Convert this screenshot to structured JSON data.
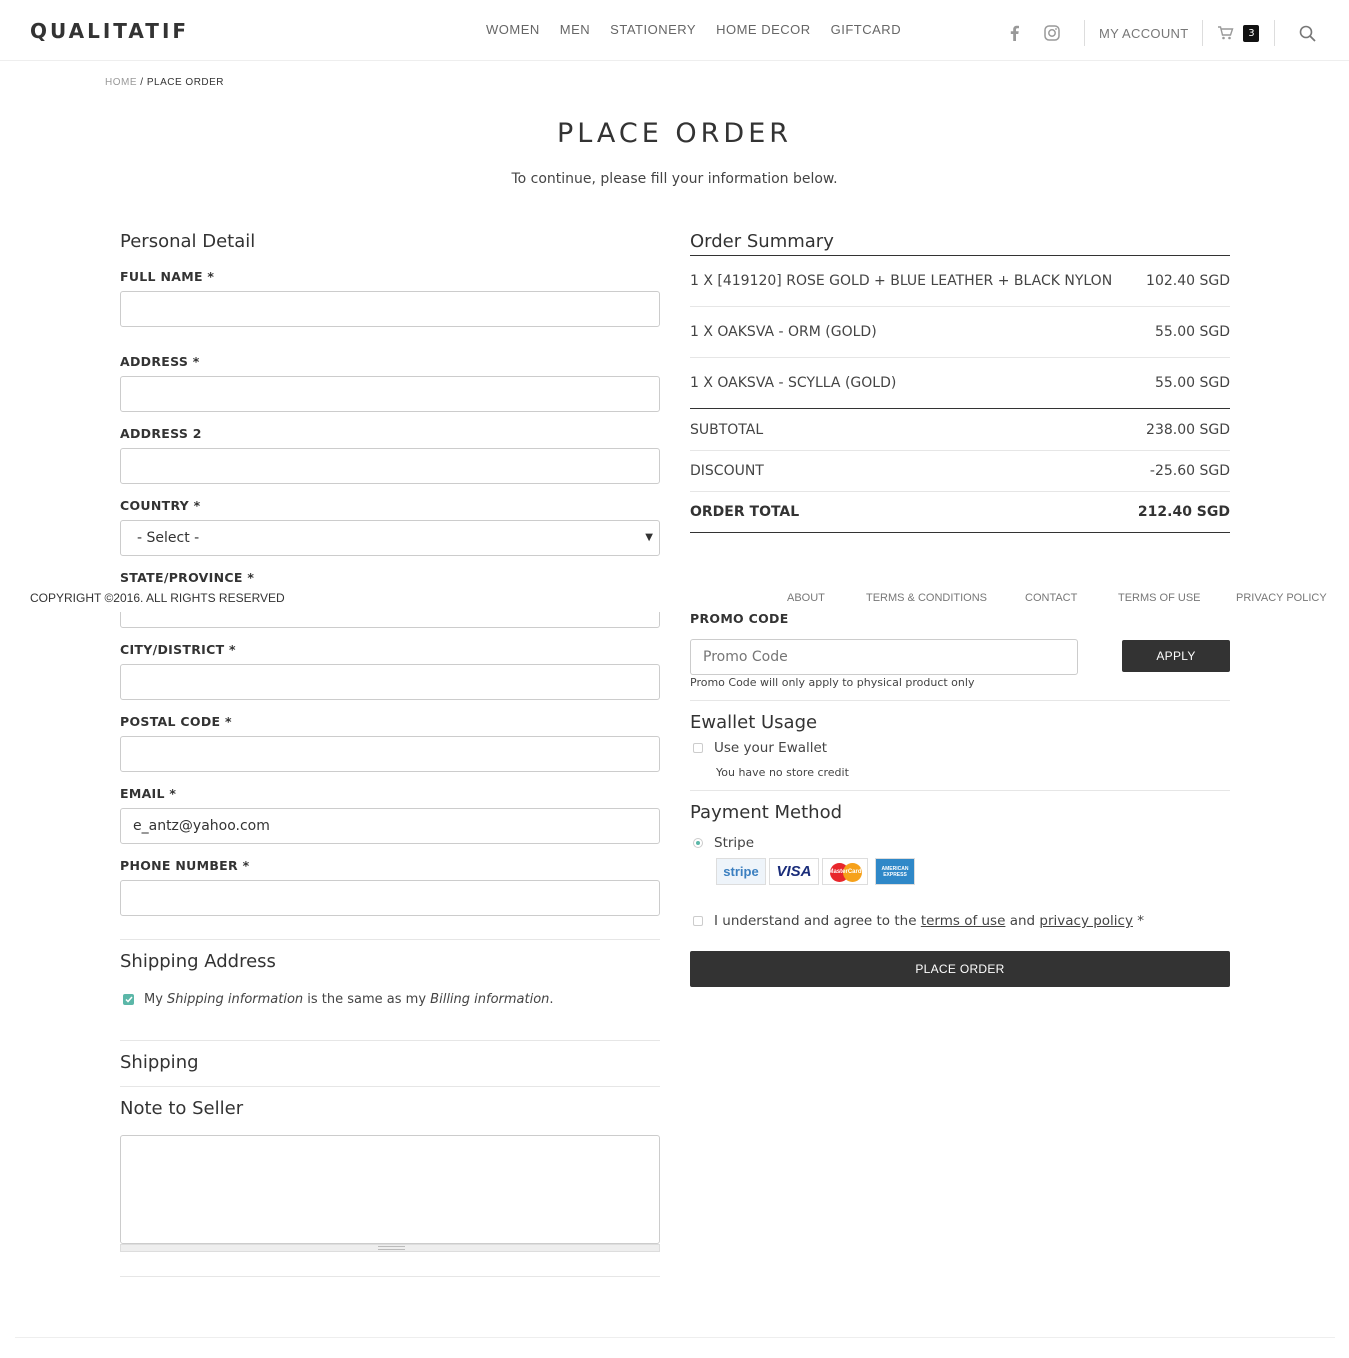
{
  "header": {
    "logo": "QUALITATIF",
    "nav": [
      "WOMEN",
      "MEN",
      "STATIONERY",
      "HOME DECOR",
      "GIFTCARD"
    ],
    "my_account": "MY ACCOUNT",
    "cart_count": "3"
  },
  "breadcrumb": {
    "home": "HOME",
    "sep": " / ",
    "current": "PLACE ORDER"
  },
  "page": {
    "title": "PLACE ORDER",
    "subtitle": "To continue, please fill your information below."
  },
  "personal": {
    "heading": "Personal Detail",
    "full_name_label": "FULL NAME *",
    "address_label": "ADDRESS *",
    "address2_label": "ADDRESS 2",
    "country_label": "COUNTRY *",
    "country_value": "- Select -",
    "state_label": "STATE/PROVINCE *",
    "city_label": "CITY/DISTRICT *",
    "postal_label": "POSTAL CODE *",
    "email_label": "EMAIL *",
    "email_value": "e_antz@yahoo.com",
    "phone_label": "PHONE NUMBER *"
  },
  "shipping_address": {
    "heading": "Shipping Address",
    "same_text_1": "My ",
    "same_text_2": "Shipping information",
    "same_text_3": " is the same as my ",
    "same_text_4": "Billing information",
    "same_text_5": "."
  },
  "shipping": {
    "heading": "Shipping"
  },
  "note": {
    "heading": "Note to Seller"
  },
  "order_summary": {
    "heading": "Order Summary",
    "items": [
      {
        "name": "1 X [419120] ROSE GOLD + BLUE LEATHER + BLACK NYLON",
        "amount": "102.40 SGD"
      },
      {
        "name": "1 X OAKSVA - ORM (GOLD)",
        "amount": "55.00 SGD"
      },
      {
        "name": "1 X OAKSVA - SCYLLA (GOLD)",
        "amount": "55.00 SGD"
      }
    ],
    "subtotal_label": "SUBTOTAL",
    "subtotal": "238.00 SGD",
    "discount_label": "DISCOUNT",
    "discount": "-25.60 SGD",
    "total_label": "ORDER TOTAL",
    "total": "212.40 SGD"
  },
  "footer": {
    "copyright": "COPYRIGHT ©2016. ALL RIGHTS RESERVED",
    "links": [
      "ABOUT",
      "TERMS & CONDITIONS",
      "CONTACT",
      "TERMS OF USE",
      "PRIVACY POLICY"
    ]
  },
  "promo": {
    "label": "PROMO CODE",
    "placeholder": "Promo Code",
    "apply": "APPLY",
    "note": "Promo Code will only apply to physical product only"
  },
  "ewallet": {
    "heading": "Ewallet Usage",
    "use_label": "Use your Ewallet",
    "credit_note": "You have no store credit"
  },
  "payment": {
    "heading": "Payment Method",
    "method": "Stripe",
    "cards": [
      "stripe",
      "VISA",
      "MasterCard",
      "AMERICAN EXPRESS"
    ]
  },
  "agree": {
    "text_1": "I understand and agree to the ",
    "terms": "terms of use",
    "text_2": " and ",
    "privacy": "privacy policy",
    "text_3": " *"
  },
  "place_order_button": "PLACE ORDER",
  "colors": {
    "accent": "#5bb7a8",
    "dark_button": "#333333"
  }
}
